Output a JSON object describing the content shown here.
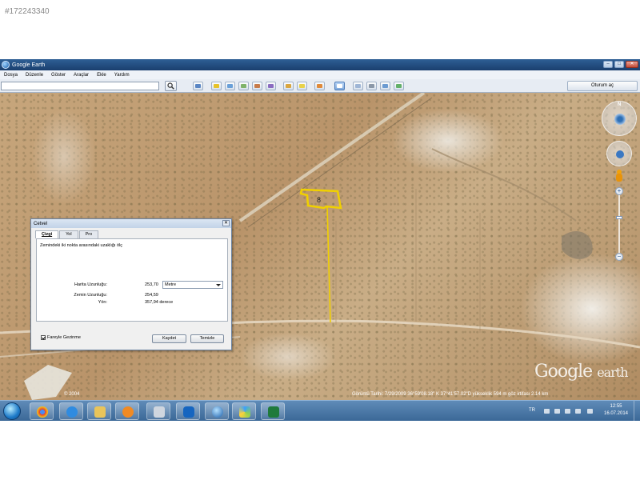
{
  "listing_id": "#172243340",
  "window": {
    "title": "Google Earth",
    "minimize_icon": "minimize-icon",
    "maximize_icon": "maximize-icon",
    "close_icon": "close-icon"
  },
  "menu": [
    "Dosya",
    "Düzenle",
    "Göster",
    "Araçlar",
    "Ekle",
    "Yardım"
  ],
  "toolbar": {
    "search_value": "",
    "sign_in": "Oturum aç"
  },
  "map": {
    "parcel_number": "8",
    "logo_google": "Google",
    "logo_earth": "earth",
    "image_year": "© 2004",
    "status": "Görüntü Tarihi: 7/29/2009   36°59'08.18\" K  37°41'57.02\"D  yükseklik  594 m    göz irtifası  2.14 km",
    "parcel_color": "#f0d000",
    "compass_letter": "N"
  },
  "ruler": {
    "title": "Cetvel",
    "tabs": [
      "Çizgi",
      "Yol",
      "Pro"
    ],
    "instruction": "Zemindeki iki nokta arasındaki uzaklığı ölç",
    "map_length_label": "Harita Uzunluğu:",
    "map_length_value": "253,70",
    "unit": "Metre",
    "ground_length_label": "Zemin Uzunluğu:",
    "ground_length_value": "254,59",
    "heading_label": "Yön:",
    "heading_value": "357,94 derece",
    "mouse_nav": "Fareyle Gezinme",
    "save_button": "Kaydet",
    "clear_button": "Temizle"
  },
  "taskbar": {
    "apps": [
      "chrome-icon",
      "internet-explorer-icon",
      "file-explorer-icon",
      "media-player-icon",
      "calculator-icon",
      "teamviewer-icon",
      "google-earth-icon",
      "pinwheel-icon",
      "excel-icon"
    ],
    "language": "TR",
    "time": "12:55",
    "date": "16.07.2014"
  }
}
